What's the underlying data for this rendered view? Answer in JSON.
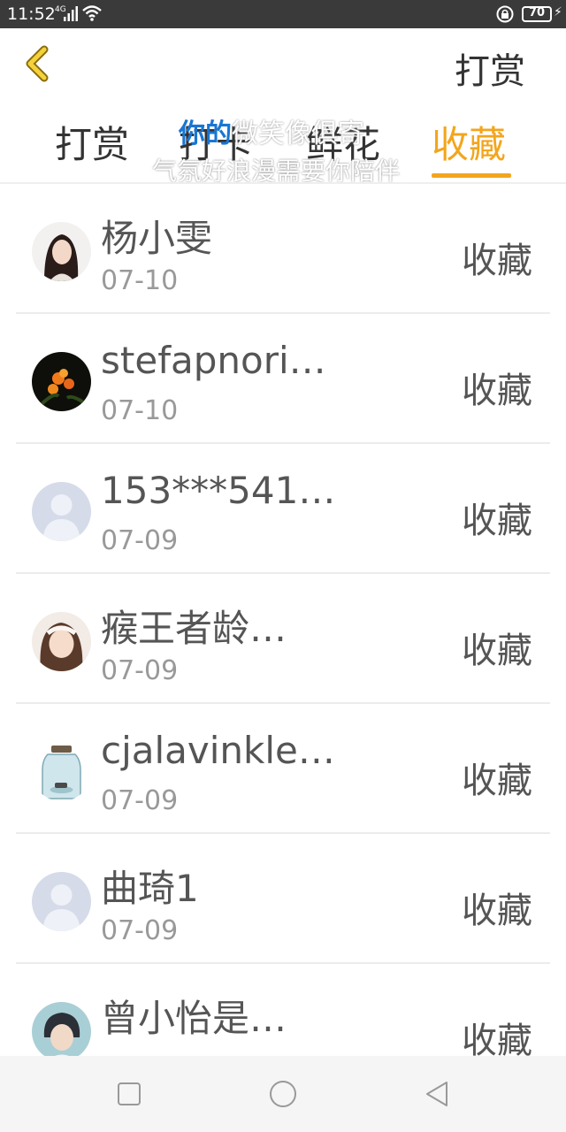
{
  "status_bar": {
    "time": "11:52",
    "network": "4G",
    "battery": "70"
  },
  "header": {
    "action_label": "打赏"
  },
  "tabs": [
    {
      "label": "打赏"
    },
    {
      "label": "打卡"
    },
    {
      "label": "鲜花"
    },
    {
      "label": "收藏"
    }
  ],
  "overlay": {
    "highlight": "你的",
    "line1_rest": "微笑像俱寄",
    "line2": "气氛好浪漫需要你陪伴"
  },
  "list": {
    "items": [
      {
        "name": "杨小雯",
        "date": "07-10",
        "action": "收藏",
        "avatar": "girl-photo"
      },
      {
        "name": "stefapnori…",
        "date": "07-10",
        "action": "收藏",
        "avatar": "flower-photo"
      },
      {
        "name": "153***541…",
        "date": "07-09",
        "action": "收藏",
        "avatar": "default-person"
      },
      {
        "name": "瘊王者龄…",
        "date": "07-09",
        "action": "收藏",
        "avatar": "child-photo"
      },
      {
        "name": "cjalavinkle…",
        "date": "07-09",
        "action": "收藏",
        "avatar": "jar-photo"
      },
      {
        "name": "曲琦1",
        "date": "07-09",
        "action": "收藏",
        "avatar": "default-person"
      },
      {
        "name": "曾小怡是…",
        "date": "",
        "action": "收藏",
        "avatar": "boy-photo"
      }
    ]
  },
  "colors": {
    "accent": "#f3a51c",
    "status_bar": "#3a3a3a",
    "text": "#555555",
    "date": "#999999"
  }
}
